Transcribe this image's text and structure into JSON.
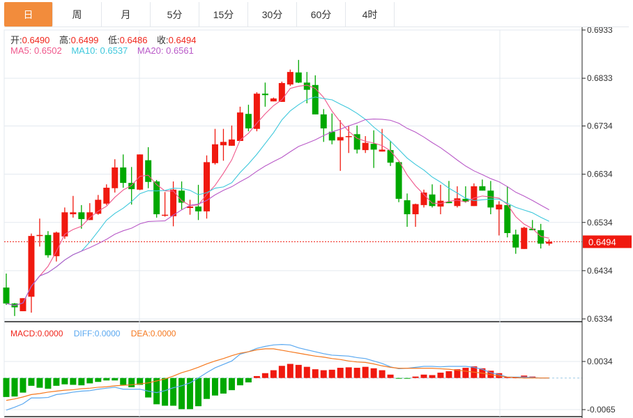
{
  "tabs": [
    {
      "label": "日",
      "active": true
    },
    {
      "label": "周"
    },
    {
      "label": "月"
    },
    {
      "label": "5分"
    },
    {
      "label": "15分"
    },
    {
      "label": "30分"
    },
    {
      "label": "60分"
    },
    {
      "label": "4时"
    }
  ],
  "ohlc_header": {
    "open_label": "开:",
    "open": "0.6490",
    "high_label": "高:",
    "high": "0.6499",
    "low_label": "低:",
    "low": "0.6486",
    "close_label": "收:",
    "close": "0.6494"
  },
  "ma_header": {
    "ma5": "MA5: 0.6502",
    "ma10": "MA10: 0.6537",
    "ma20": "MA20: 0.6561"
  },
  "macd_header": {
    "macd": "MACD:0.0000",
    "diff": "DIFF:0.0000",
    "dea": "DEA:0.0000"
  },
  "colors": {
    "up": "#f0190f",
    "down": "#00a800",
    "ma5": "#f0588c",
    "ma10": "#3ec8dc",
    "ma20": "#b95ac8",
    "diff": "#5aa8f0",
    "dea": "#f5781e",
    "accent": "#f28c3c"
  },
  "chart_data": [
    {
      "type": "candlestick",
      "title": "",
      "ylim": [
        0.6334,
        0.6933
      ],
      "yticks": [
        "0.6933",
        "0.6833",
        "0.6734",
        "0.6634",
        "0.6534",
        "0.6434",
        "0.6334"
      ],
      "current_price": "0.6494",
      "ma_periods": [
        5,
        10,
        20
      ],
      "candles": [
        [
          0.6399,
          0.6428,
          0.6363,
          0.6366
        ],
        [
          0.6366,
          0.6367,
          0.634,
          0.6358
        ],
        [
          0.635,
          0.6377,
          0.635,
          0.6377
        ],
        [
          0.638,
          0.6511,
          0.6347,
          0.6506
        ],
        [
          0.6506,
          0.6542,
          0.6484,
          0.6508
        ],
        [
          0.6508,
          0.6516,
          0.6461,
          0.6466
        ],
        [
          0.6464,
          0.6515,
          0.6453,
          0.6513
        ],
        [
          0.6505,
          0.6565,
          0.65,
          0.6555
        ],
        [
          0.6551,
          0.6589,
          0.6544,
          0.6555
        ],
        [
          0.6555,
          0.657,
          0.6521,
          0.6541
        ],
        [
          0.6539,
          0.6574,
          0.6539,
          0.6555
        ],
        [
          0.6552,
          0.6591,
          0.655,
          0.6581
        ],
        [
          0.6573,
          0.6613,
          0.657,
          0.6606
        ],
        [
          0.6605,
          0.6665,
          0.6596,
          0.6648
        ],
        [
          0.6648,
          0.6675,
          0.6606,
          0.6616
        ],
        [
          0.6616,
          0.6649,
          0.6571,
          0.6603
        ],
        [
          0.6602,
          0.6675,
          0.6601,
          0.6675
        ],
        [
          0.6663,
          0.669,
          0.6605,
          0.6618
        ],
        [
          0.6619,
          0.6622,
          0.6544,
          0.6551
        ],
        [
          0.6548,
          0.6597,
          0.6546,
          0.655
        ],
        [
          0.6547,
          0.6619,
          0.6526,
          0.6602
        ],
        [
          0.66,
          0.6619,
          0.6561,
          0.6575
        ],
        [
          0.6564,
          0.6581,
          0.655,
          0.6567
        ],
        [
          0.6567,
          0.6612,
          0.6539,
          0.6557
        ],
        [
          0.6557,
          0.6673,
          0.6542,
          0.6659
        ],
        [
          0.6657,
          0.6728,
          0.6654,
          0.6696
        ],
        [
          0.6694,
          0.6728,
          0.6662,
          0.6701
        ],
        [
          0.6693,
          0.6735,
          0.6693,
          0.6706
        ],
        [
          0.6703,
          0.6774,
          0.6703,
          0.6762
        ],
        [
          0.6759,
          0.6778,
          0.6723,
          0.6729
        ],
        [
          0.6728,
          0.6804,
          0.6723,
          0.6801
        ],
        [
          0.6801,
          0.6824,
          0.6774,
          0.6798
        ],
        [
          0.6785,
          0.6793,
          0.6785,
          0.6791
        ],
        [
          0.6784,
          0.6826,
          0.6784,
          0.6823
        ],
        [
          0.682,
          0.6851,
          0.6817,
          0.6846
        ],
        [
          0.6845,
          0.6871,
          0.6823,
          0.6824
        ],
        [
          0.6824,
          0.6846,
          0.6781,
          0.6809
        ],
        [
          0.6819,
          0.6839,
          0.6758,
          0.6758
        ],
        [
          0.6758,
          0.6769,
          0.6701,
          0.6729
        ],
        [
          0.6722,
          0.676,
          0.6696,
          0.6704
        ],
        [
          0.6704,
          0.6746,
          0.6641,
          0.6711
        ],
        [
          0.6711,
          0.6735,
          0.6678,
          0.6713
        ],
        [
          0.6717,
          0.6735,
          0.6677,
          0.6685
        ],
        [
          0.6684,
          0.6713,
          0.6678,
          0.6699
        ],
        [
          0.6697,
          0.6725,
          0.6647,
          0.6685
        ],
        [
          0.6681,
          0.6728,
          0.6681,
          0.6685
        ],
        [
          0.6684,
          0.6703,
          0.6651,
          0.6658
        ],
        [
          0.6659,
          0.666,
          0.6576,
          0.6583
        ],
        [
          0.658,
          0.6594,
          0.6525,
          0.6551
        ],
        [
          0.6551,
          0.6573,
          0.6525,
          0.6572
        ],
        [
          0.657,
          0.6602,
          0.6565,
          0.6596
        ],
        [
          0.6592,
          0.6613,
          0.6565,
          0.6568
        ],
        [
          0.6567,
          0.6612,
          0.6551,
          0.6579
        ],
        [
          0.6577,
          0.662,
          0.6574,
          0.6574
        ],
        [
          0.6568,
          0.6609,
          0.6565,
          0.6584
        ],
        [
          0.6583,
          0.6609,
          0.6575,
          0.6577
        ],
        [
          0.6568,
          0.6615,
          0.6568,
          0.6609
        ],
        [
          0.6609,
          0.6623,
          0.66,
          0.66
        ],
        [
          0.66,
          0.662,
          0.6551,
          0.6565
        ],
        [
          0.6561,
          0.6578,
          0.6507,
          0.6571
        ],
        [
          0.657,
          0.6609,
          0.6503,
          0.6512
        ],
        [
          0.6509,
          0.6519,
          0.6469,
          0.6482
        ],
        [
          0.6479,
          0.6525,
          0.6479,
          0.6523
        ],
        [
          0.6521,
          0.6539,
          0.6518,
          0.6518
        ],
        [
          0.6518,
          0.6531,
          0.648,
          0.649
        ],
        [
          0.649,
          0.6499,
          0.6486,
          0.6494
        ]
      ]
    },
    {
      "type": "bar+line",
      "title": "MACD",
      "ylim": [
        -0.0065,
        0.0034
      ],
      "yticks": [
        "0.0034",
        "-0.0065"
      ],
      "macd": [
        -0.0039,
        -0.0038,
        -0.003,
        -0.0016,
        -0.002,
        -0.0022,
        -0.0016,
        -0.0013,
        -0.0014,
        -0.0015,
        -0.0011,
        -0.0008,
        -0.0005,
        -0.0005,
        -0.0014,
        -0.0019,
        -0.0014,
        -0.004,
        -0.0054,
        -0.0057,
        -0.0057,
        -0.0064,
        -0.0064,
        -0.0058,
        -0.0043,
        -0.0036,
        -0.0032,
        -0.0025,
        -0.0015,
        -0.0009,
        0.0004,
        0.001,
        0.0016,
        0.0025,
        0.0029,
        0.0027,
        0.0023,
        0.0018,
        0.0016,
        0.0017,
        0.0021,
        0.0022,
        0.0021,
        0.0023,
        0.002,
        0.0016,
        0.0007,
        -0.0001,
        -0.0001,
        0.0003,
        0.0007,
        0.0006,
        0.0011,
        0.0014,
        0.0018,
        0.0021,
        0.0024,
        0.002,
        0.0015,
        0.001,
        0.0002,
        0.0001,
        0.0005,
        0.0003,
        0.0,
        0.0
      ],
      "diff": [
        -0.0066,
        -0.006,
        -0.0053,
        -0.0041,
        -0.0041,
        -0.004,
        -0.0034,
        -0.0032,
        -0.0029,
        -0.0027,
        -0.0026,
        -0.0023,
        -0.0021,
        -0.0019,
        -0.0023,
        -0.0023,
        -0.0023,
        -0.0027,
        -0.003,
        -0.0026,
        -0.002,
        -0.0016,
        -0.001,
        0.0,
        0.0011,
        0.0021,
        0.0028,
        0.0035,
        0.0049,
        0.0054,
        0.0061,
        0.0065,
        0.0068,
        0.0069,
        0.0068,
        0.0062,
        0.0058,
        0.0054,
        0.005,
        0.0047,
        0.0046,
        0.0045,
        0.0042,
        0.004,
        0.0035,
        0.003,
        0.0023,
        0.0019,
        0.002,
        0.0022,
        0.0024,
        0.0024,
        0.0023,
        0.0024,
        0.0024,
        0.0024,
        0.0022,
        0.0018,
        0.0011,
        0.0007,
        0.0002,
        0.0002,
        0.0002,
        0.0001,
        0.0,
        0.0
      ],
      "dea": [
        -0.0046,
        -0.0043,
        -0.0039,
        -0.0034,
        -0.0032,
        -0.0029,
        -0.0027,
        -0.0025,
        -0.0024,
        -0.0022,
        -0.0021,
        -0.0019,
        -0.0018,
        -0.0016,
        -0.0015,
        -0.0014,
        -0.0012,
        -0.001,
        -0.0006,
        -0.0002,
        0.0004,
        0.0011,
        0.0016,
        0.0022,
        0.0029,
        0.0035,
        0.004,
        0.0046,
        0.0051,
        0.0054,
        0.0058,
        0.006,
        0.006,
        0.0057,
        0.0054,
        0.0051,
        0.0048,
        0.0045,
        0.0043,
        0.004,
        0.0038,
        0.0035,
        0.0033,
        0.0032,
        0.0029,
        0.0025,
        0.0022,
        0.002,
        0.002,
        0.002,
        0.002,
        0.002,
        0.0019,
        0.0018,
        0.0016,
        0.0014,
        0.0012,
        0.001,
        0.0007,
        0.0004,
        0.0002,
        0.0001,
        0.0,
        0.0,
        0.0,
        0.0
      ]
    }
  ]
}
